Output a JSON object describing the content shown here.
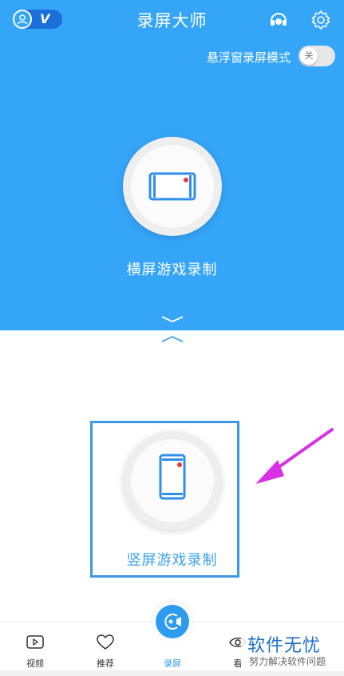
{
  "header": {
    "title": "录屏大师",
    "vip_label": "V"
  },
  "float_mode": {
    "label": "悬浮窗录屏模式",
    "toggle_state": "关"
  },
  "modes": {
    "landscape_label": "横屏游戏录制",
    "portrait_label": "竖屏游戏录制"
  },
  "nav": {
    "video": "视频",
    "recommend": "推荐",
    "record": "录屏",
    "watch": "看"
  },
  "watermark": {
    "title": "软件无忧",
    "subtitle": "努力解决软件问题"
  },
  "colors": {
    "primary": "#35a5f8",
    "highlight": "#3e97e8",
    "arrow": "#d930e6",
    "record_dot": "#e53935"
  }
}
